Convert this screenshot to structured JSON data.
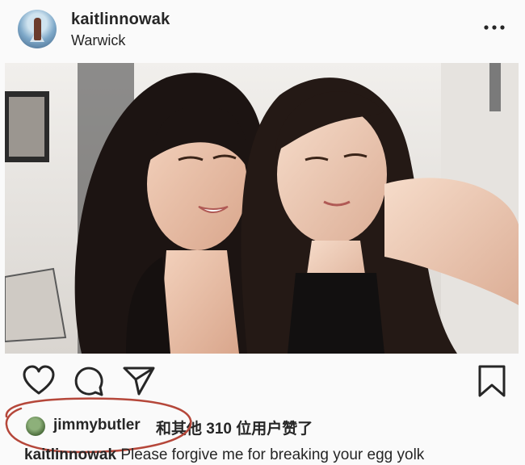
{
  "post": {
    "username": "kaitlinnowak",
    "location": "Warwick",
    "more_icon": "more-horizontal-icon"
  },
  "actions": {
    "like_icon": "heart-icon",
    "comment_icon": "comment-icon",
    "share_icon": "send-icon",
    "save_icon": "bookmark-icon"
  },
  "likes": {
    "liker": "jimmybutler",
    "rest": "和其他 310 位用户赞了",
    "annotation_color": "#b5473a"
  },
  "caption": {
    "username": "kaitlinnowak",
    "text": "Please forgive me for breaking your egg yolk"
  }
}
